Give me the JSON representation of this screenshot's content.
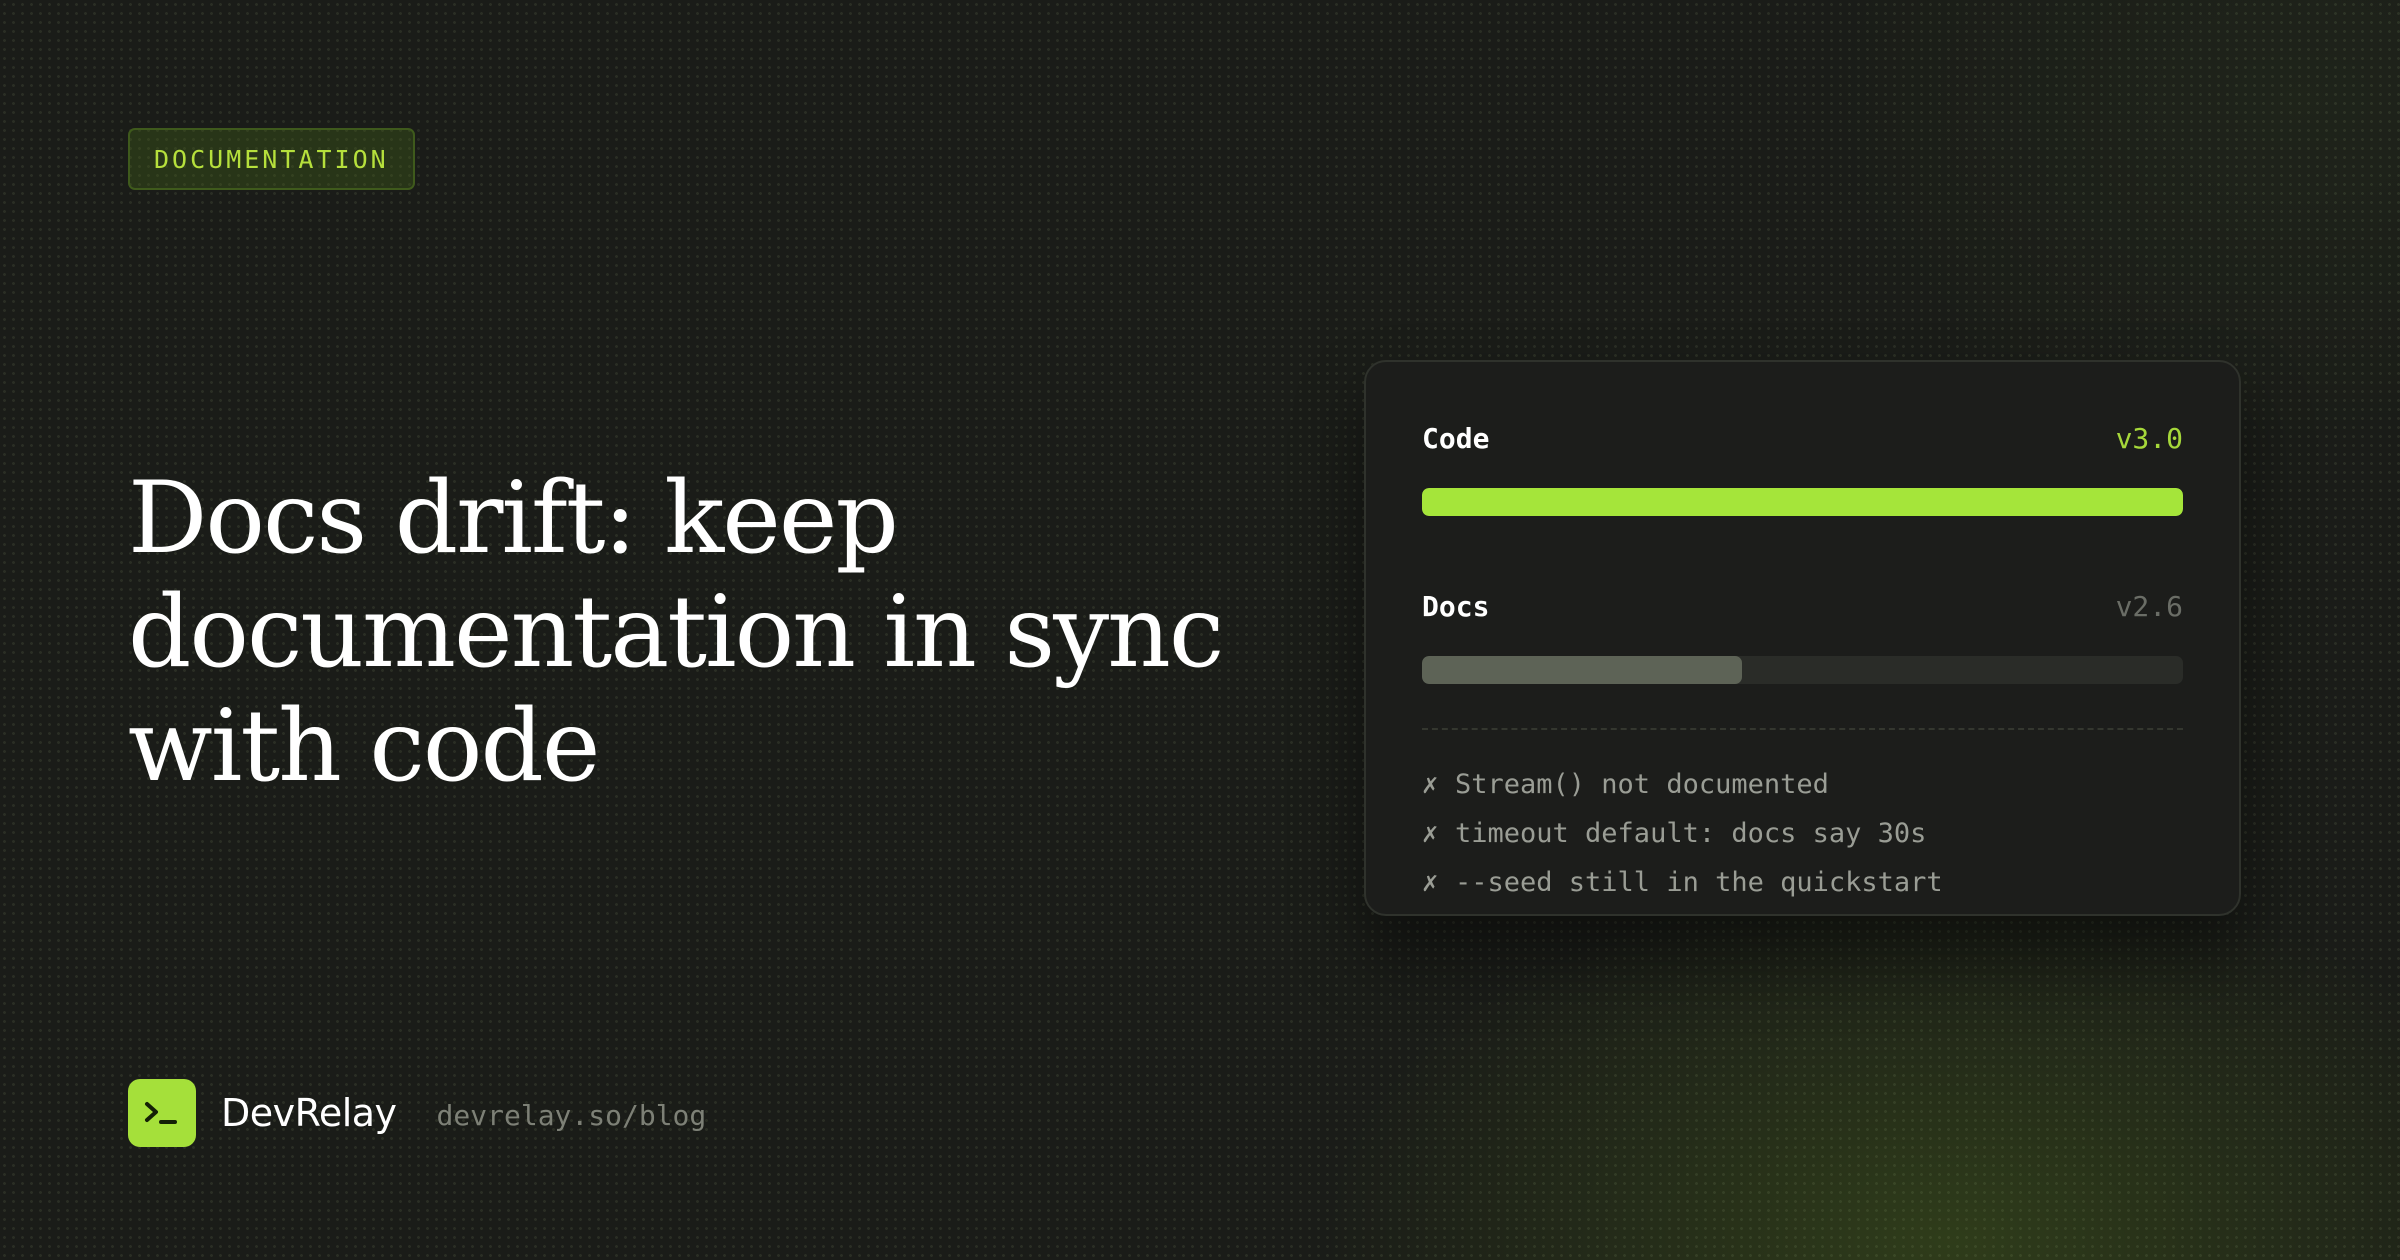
{
  "tag": {
    "label": "DOCUMENTATION"
  },
  "headline": {
    "line1": "Docs drift: keep",
    "line2": "documentation in sync",
    "line3": "with code"
  },
  "card": {
    "code": {
      "label": "Code",
      "version": "v3.0",
      "progress": 1.0
    },
    "docs": {
      "label": "Docs",
      "version": "v2.6",
      "progress": 0.42
    },
    "issues": [
      {
        "mark": "✗",
        "text": "Stream() not documented"
      },
      {
        "mark": "✗",
        "text": "timeout default: docs say 30s"
      },
      {
        "mark": "✗",
        "text": "--seed still in the quickstart"
      }
    ]
  },
  "footer": {
    "logo_icon": "terminal-prompt-icon",
    "brand": "DevRelay",
    "url": "devrelay.so/blog"
  },
  "colors": {
    "background": "#1a1c18",
    "accent": "#a5e53a",
    "card": "#1c1d1b",
    "docs_bar": "#5d6356",
    "muted_text": "#9a9d95"
  }
}
